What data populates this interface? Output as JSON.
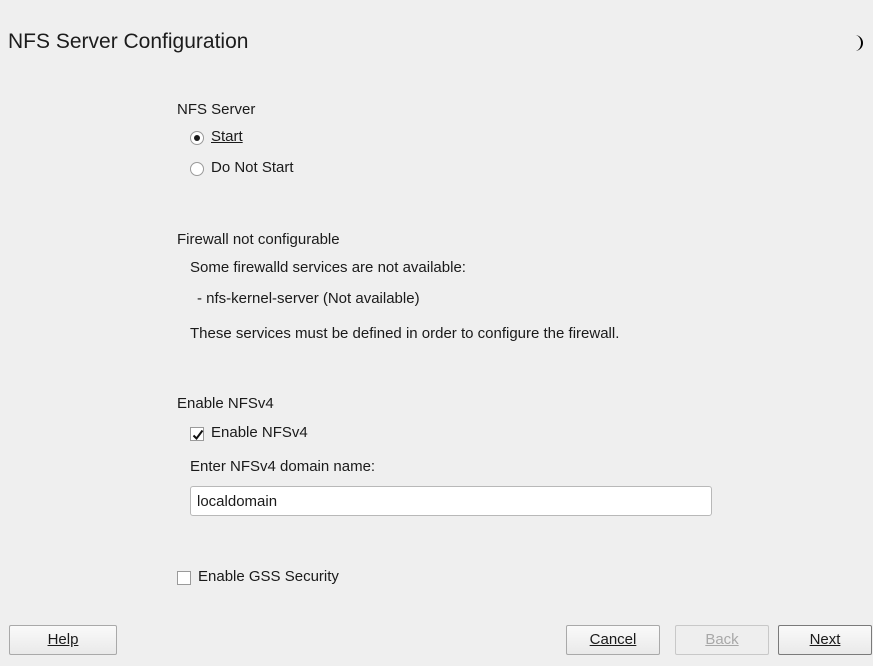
{
  "header": {
    "title": "NFS Server Configuration"
  },
  "nfs_server": {
    "heading": "NFS Server",
    "start_label": "Start",
    "do_not_start_label": "Do Not Start",
    "selected": "Start"
  },
  "firewall": {
    "heading": "Firewall not configurable",
    "line1": "Some firewalld services are not available:",
    "line2": "- nfs-kernel-server (Not available)",
    "line3": "These services must be defined in order to configure the firewall."
  },
  "nfsv4": {
    "heading": "Enable NFSv4",
    "checkbox_label": "Enable NFSv4",
    "checked": true,
    "domain_label": "Enter NFSv4 domain name:",
    "domain_value": "localdomain"
  },
  "gss": {
    "checkbox_label": "Enable GSS Security",
    "checked": false
  },
  "buttons": {
    "help": "Help",
    "cancel": "Cancel",
    "back": "Back",
    "next": "Next"
  }
}
